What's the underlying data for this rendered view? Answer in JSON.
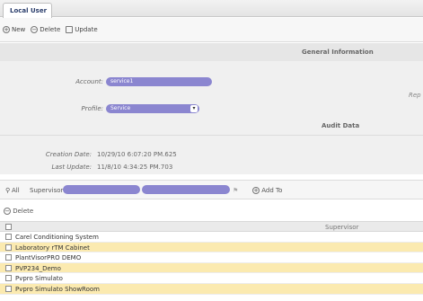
{
  "tab": {
    "label": "Local User"
  },
  "toolbar": {
    "new_label": "New",
    "delete_label": "Delete",
    "update_label": "Update"
  },
  "general": {
    "title": "General Information",
    "account_label": "Account:",
    "account_value": "service1",
    "profile_label": "Profile:",
    "profile_value": "Service",
    "rep_text": "Rep"
  },
  "audit": {
    "title": "Audit Data",
    "creation_label": "Creation Date:",
    "creation_value": "10/29/10 6:07:20 PM.625",
    "last_update_label": "Last Update:",
    "last_update_value": "11/8/10 4:34:25 PM.703"
  },
  "supervisor_bar": {
    "all_label": "All",
    "supervisor_label": "Supervisor:",
    "add_to_label": "Add To"
  },
  "list": {
    "delete_label": "Delete",
    "header_supervisor": "Supervisor",
    "rows": [
      "Carel Conditioning System",
      "Laboratory rTM Cabinet",
      "PlantVisorPRO DEMO",
      "PVP234_Demo",
      "Pvpro Simulato",
      "Pvpro Simulato ShowRoom"
    ]
  },
  "colors": {
    "pill": "#8b86d0",
    "row_highlight": "#fbeab0"
  }
}
